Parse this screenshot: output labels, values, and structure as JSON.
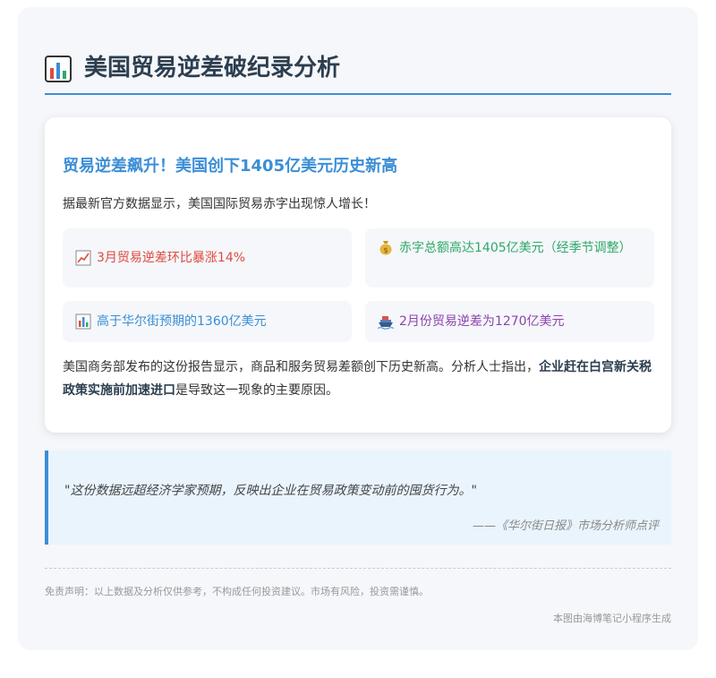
{
  "page": {
    "title": "美国贸易逆差破纪录分析",
    "title_icon": "bar-chart-icon"
  },
  "card": {
    "headline": "贸易逆差飙升！美国创下1405亿美元历史新高",
    "intro": "据最新官方数据显示，美国国际贸易赤字出现惊人增长！",
    "facts": [
      {
        "icon": "chart-increasing-icon",
        "text": "3月贸易逆差环比暴涨14%",
        "color": "#e04a3f"
      },
      {
        "icon": "money-bag-icon",
        "text": "赤字总额高达1405亿美元（经季节调整）",
        "color": "#2ea86a"
      },
      {
        "icon": "bar-chart-icon",
        "text": "高于华尔街预期的1360亿美元",
        "color": "#3b8ed5"
      },
      {
        "icon": "ship-icon",
        "text": "2月份贸易逆差为1270亿美元",
        "color": "#8e44ad"
      }
    ],
    "body_prefix": "美国商务部发布的这份报告显示，商品和服务贸易差额创下历史新高。分析人士指出，",
    "body_bold": "企业赶在白宫新关税政策实施前加速进口",
    "body_suffix": "是导致这一现象的主要原因。"
  },
  "quote": {
    "text": "\"这份数据远超经济学家预期，反映出企业在贸易政策变动前的囤货行为。\"",
    "source": "——《华尔街日报》市场分析师点评"
  },
  "footer": {
    "disclaimer": "免责声明：以上数据及分析仅供参考，不构成任何投资建议。市场有风险，投资需谨慎。",
    "generated_by": "本图由海博笔记小程序生成"
  },
  "colors": {
    "accent": "#3b8ed5",
    "red": "#e04a3f",
    "green": "#2ea86a",
    "purple": "#8e44ad"
  }
}
